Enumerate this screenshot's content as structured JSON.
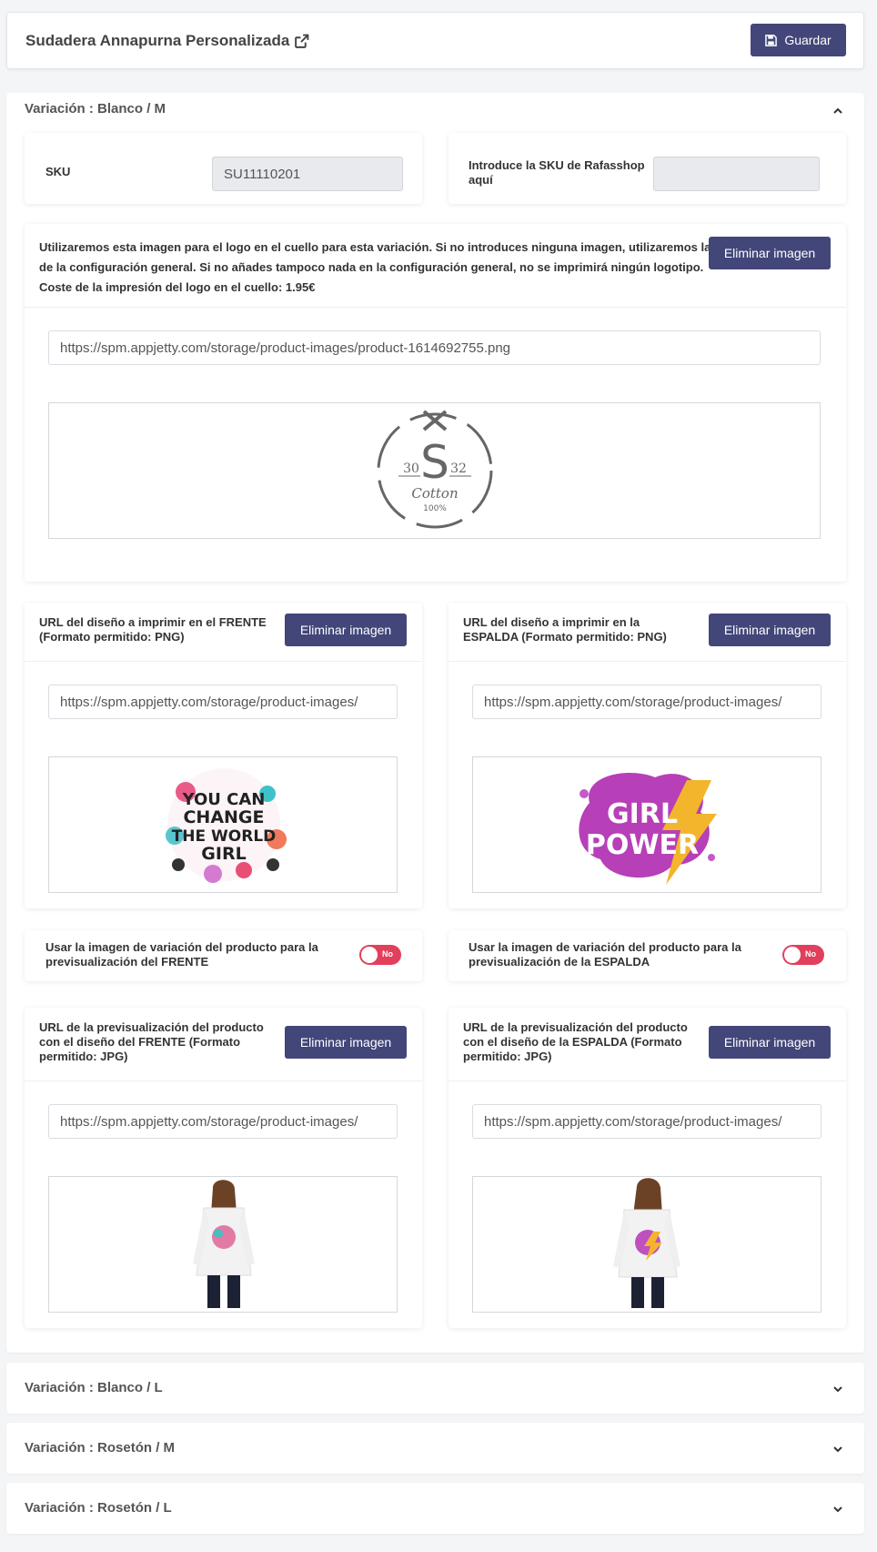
{
  "header": {
    "title": "Sudadera Annapurna Personalizada",
    "save_label": "Guardar"
  },
  "variation_open": {
    "title": "Variación : Blanco / M",
    "sku_label": "SKU",
    "sku_value": "SU11110201",
    "rafasshop_label": "Introduce la SKU de Rafasshop aquí",
    "rafasshop_value": "",
    "logo_text": "Utilizaremos esta imagen para el logo en el cuello para esta variación. Si no introduces ninguna imagen, utilizaremos la de la configuración general. Si no añades tampoco nada en la configuración general, no se imprimirá ningún logotipo. Coste de la impresión del logo en el cuello: 1.95€",
    "logo_url": "https://spm.appjetty.com/storage/product-images/product-1614692755.png",
    "logo_image": {
      "left_number": "30",
      "letter": "S",
      "right_number": "32",
      "word": "Cotton",
      "percent": "100%"
    },
    "front_label": "URL del diseño a imprimir en el FRENTE (Formato permitido: PNG)",
    "front_url": "https://spm.appjetty.com/storage/product-images/",
    "front_image_lines": [
      "YOU CAN",
      "CHANGE",
      "THE WORLD",
      "GIRL"
    ],
    "back_label": "URL del diseño a imprimir en la ESPALDA (Formato permitido: PNG)",
    "back_url": "https://spm.appjetty.com/storage/product-images/",
    "back_image_lines": [
      "GIRL",
      "POWER"
    ],
    "front_toggle_label": "Usar la imagen de variación del producto para la previsualización del FRENTE",
    "back_toggle_label": "Usar la imagen de variación del producto para la previsualización de la ESPALDA",
    "toggle_value": "No",
    "front_preview_label": "URL de la previsualización del producto con el diseño del FRENTE (Formato permitido: JPG)",
    "front_preview_url": "https://spm.appjetty.com/storage/product-images/",
    "back_preview_label": "URL de la previsualización del producto con el diseño de la ESPALDA (Formato permitido: JPG)",
    "back_preview_url": "https://spm.appjetty.com/storage/product-images/",
    "delete_label": "Eliminar imagen"
  },
  "variations_collapsed": [
    {
      "title": "Variación : Blanco / L"
    },
    {
      "title": "Variación : Rosetón / M"
    },
    {
      "title": "Variación : Rosetón / L"
    }
  ],
  "colors": {
    "button": "#424679",
    "toggle_off": "#e23f5c",
    "page_bg": "#f4f5f7"
  }
}
